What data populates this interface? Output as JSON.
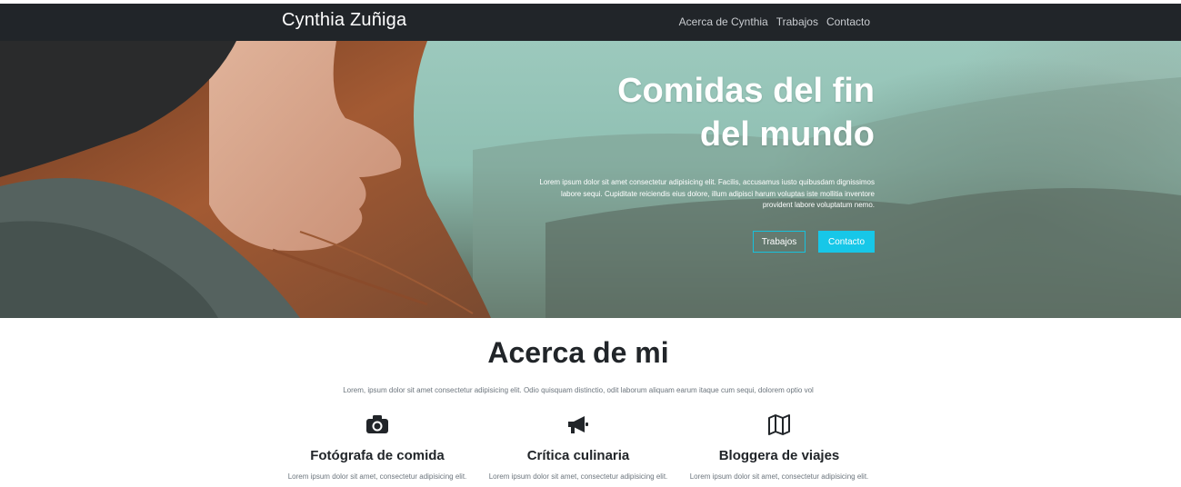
{
  "navbar": {
    "brand": "Cynthia Zuñiga",
    "links": [
      "Acerca de Cynthia",
      "Trabajos",
      "Contacto"
    ]
  },
  "hero": {
    "title_line1": "Comidas del fin",
    "title_line2": "del mundo",
    "text": "Lorem ipsum dolor sit amet consectetur adipisicing elit. Facilis, accusamus iusto quibusdam dignissimos labore sequi. Cupiditate reiciendis eius dolore, illum adipisci harum voluptas iste mollitia inventore provident labore voluptatum nemo.",
    "button_works": "Trabajos",
    "button_contact": "Contacto"
  },
  "about": {
    "title": "Acerca de mi",
    "text": "Lorem, ipsum dolor sit amet consectetur adipisicing elit. Odio quisquam distinctio, odit laborum aliquam earum itaque cum sequi, dolorem optio vol",
    "features": [
      {
        "icon": "camera-icon",
        "title": "Fotógrafa de comida",
        "text": "Lorem ipsum dolor sit amet, consectetur adipisicing elit."
      },
      {
        "icon": "megaphone-icon",
        "title": "Crítica culinaria",
        "text": "Lorem ipsum dolor sit amet, consectetur adipisicing elit."
      },
      {
        "icon": "map-icon",
        "title": "Bloggera de viajes",
        "text": "Lorem ipsum dolor sit amet, consectetur adipisicing elit."
      }
    ]
  },
  "colors": {
    "navbar": "#212529",
    "accent": "#17c7e8",
    "heading": "#212529",
    "muted": "#6c757d"
  }
}
